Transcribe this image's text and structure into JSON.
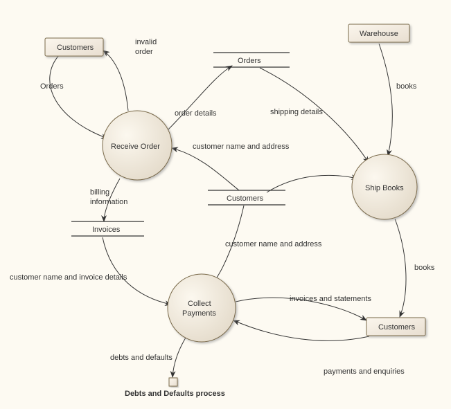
{
  "entities": {
    "customers_top": "Customers",
    "warehouse": "Warehouse",
    "customers_right": "Customers"
  },
  "processes": {
    "receive_order": "Receive Order",
    "ship_books": "Ship Books",
    "collect_payments_l1": "Collect",
    "collect_payments_l2": "Payments"
  },
  "stores": {
    "orders": "Orders",
    "customers": "Customers",
    "invoices": "Invoices"
  },
  "small_process": "Debts and Defaults process",
  "flow_labels": {
    "invalid_order_l1": "invalid",
    "invalid_order_l2": "order",
    "orders": "Orders",
    "order_details": "order details",
    "shipping_details": "shipping details",
    "books_top": "books",
    "cust_name_addr_top": "customer name and address",
    "billing_l1": "billing",
    "billing_l2": "information",
    "cust_name_addr_mid": "customer name and address",
    "cust_name_invoice": "customer name and invoice details",
    "invoices_statements": "invoices and statements",
    "books_right": "books",
    "payments_enquiries": "payments and enquiries",
    "debts_defaults": "debts and defaults"
  }
}
